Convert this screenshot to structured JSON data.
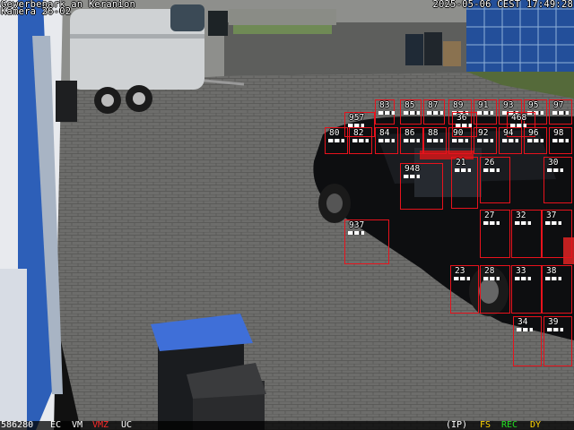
{
  "camera": {
    "title": "Gewerbepark an Keranion",
    "subtitle": "Kamera 26-02",
    "datetime": "2025-05-06 CEST 17:49:28"
  },
  "status_bar": {
    "code": "586280",
    "ec": "EC",
    "vm": "VM",
    "vmz": "VMZ",
    "uc": "UC",
    "ip": "(IP)",
    "fs": "FS",
    "rec": "REC",
    "dy": "DY"
  },
  "colors": {
    "zone_border": "#e8121c",
    "vmz": "#ff2a2a",
    "fs": "#ffd400",
    "rec": "#20e020",
    "dy": "#ffd400"
  },
  "zones": [
    {
      "label": "83"
    },
    {
      "label": "85"
    },
    {
      "label": "87"
    },
    {
      "label": "89"
    },
    {
      "label": "91"
    },
    {
      "label": "93"
    },
    {
      "label": "95"
    },
    {
      "label": "97"
    },
    {
      "label": "957"
    },
    {
      "label": "468"
    },
    {
      "label": "36"
    },
    {
      "label": "80"
    },
    {
      "label": "82"
    },
    {
      "label": "84"
    },
    {
      "label": "86"
    },
    {
      "label": "88"
    },
    {
      "label": "90"
    },
    {
      "label": "92"
    },
    {
      "label": "94"
    },
    {
      "label": "96"
    },
    {
      "label": "98"
    },
    {
      "label": "948"
    },
    {
      "label": "21"
    },
    {
      "label": "26"
    },
    {
      "label": "30"
    },
    {
      "label": "27"
    },
    {
      "label": "32"
    },
    {
      "label": "37"
    },
    {
      "label": "937"
    },
    {
      "label": "23"
    },
    {
      "label": "28"
    },
    {
      "label": "33"
    },
    {
      "label": "38"
    },
    {
      "label": "34"
    },
    {
      "label": "39"
    }
  ]
}
